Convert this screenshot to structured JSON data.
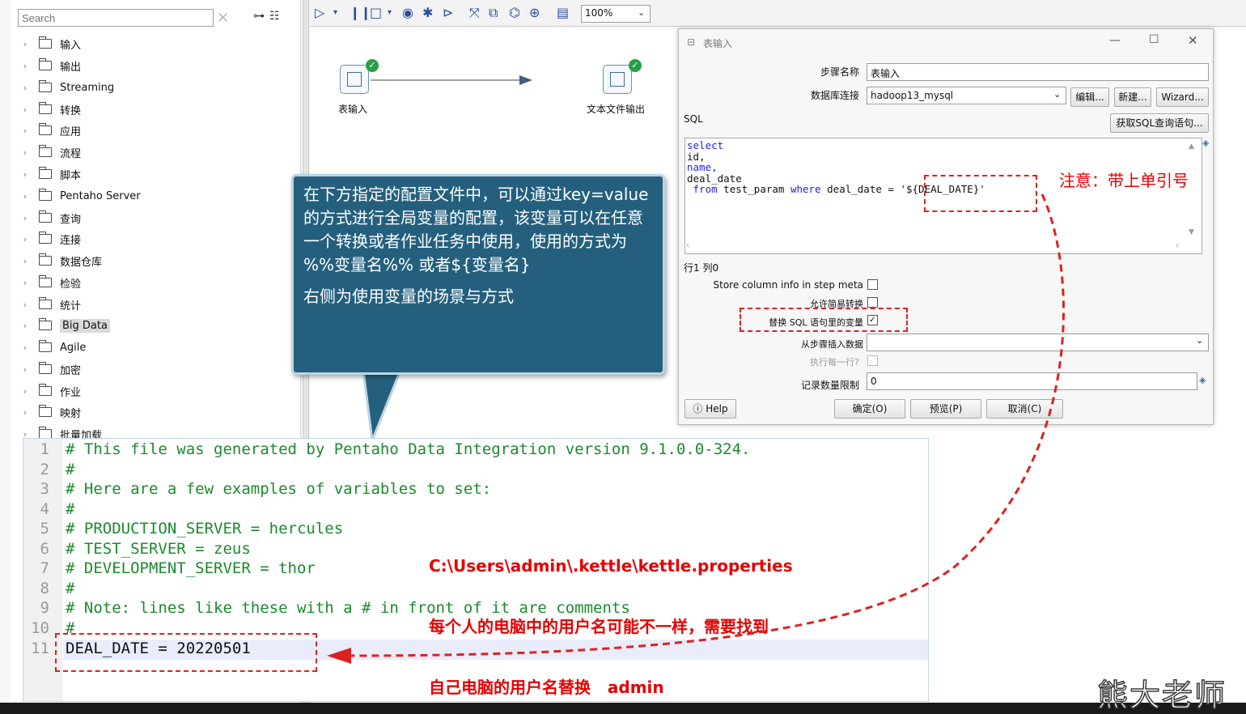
{
  "search": {
    "placeholder": "Search"
  },
  "tree": [
    {
      "label": "输入"
    },
    {
      "label": "输出"
    },
    {
      "label": "Streaming"
    },
    {
      "label": "转换"
    },
    {
      "label": "应用"
    },
    {
      "label": "流程"
    },
    {
      "label": "脚本"
    },
    {
      "label": "Pentaho Server"
    },
    {
      "label": "查询"
    },
    {
      "label": "连接"
    },
    {
      "label": "数据仓库"
    },
    {
      "label": "检验"
    },
    {
      "label": "统计"
    },
    {
      "label": "Big Data"
    },
    {
      "label": "Agile"
    },
    {
      "label": "加密"
    },
    {
      "label": "作业"
    },
    {
      "label": "映射"
    },
    {
      "label": "批量加载"
    }
  ],
  "toolbar": {
    "zoom": "100%"
  },
  "canvas": {
    "step1": "表输入",
    "step2": "文本文件输出"
  },
  "dialog": {
    "title": "表输入",
    "step_name_label": "步骤名称",
    "step_name_value": "表输入",
    "db_conn_label": "数据库连接",
    "db_conn_value": "hadoop13_mysql",
    "edit_btn": "编辑...",
    "new_btn": "新建...",
    "wizard_btn": "Wizard...",
    "sql_label": "SQL",
    "get_sql_btn": "获取SQL查询语句...",
    "sql": {
      "l1": "select",
      "l2": "id,",
      "l3": "name,",
      "l4": "deal_date",
      "l5_from": "from",
      "l5_mid": "test_param",
      "l5_where": "where",
      "l5_rest": "deal_date =",
      "l5_var": "'${DEAL_DATE}'"
    },
    "position": "行1 列0",
    "store_col_label": "Store column info in step meta",
    "lazy_label": "允许简易转换",
    "replace_var_label": "替换 SQL 语句里的变量",
    "insert_from_label": "从步骤插入数据",
    "exec_each_label": "执行每一行?",
    "limit_label": "记录数量限制",
    "limit_value": "0",
    "help_btn": "Help",
    "ok_btn": "确定(O)",
    "preview_btn": "预览(P)",
    "cancel_btn": "取消(C)"
  },
  "callout": {
    "p1": "在下方指定的配置文件中，可以通过key=value的方式进行全局变量的配置，该变量可以在任意一个转换或者作业任务中使用，使用的方式为 %%变量名%% 或者${变量名}",
    "p2": "右侧为使用变量的场景与方式"
  },
  "note_quote": "注意：带上单引号",
  "path_note": {
    "l1": "C:\\Users\\admin\\.kettle\\kettle.properties",
    "l2": "每个人的电脑中的用户名可能不一样，需要找到",
    "l3": "自己电脑的用户名替换   admin"
  },
  "editor": {
    "lines": [
      "# This file was generated by Pentaho Data Integration version 9.1.0.0-324.",
      "#",
      "# Here are a few examples of variables to set:",
      "#",
      "# PRODUCTION_SERVER = hercules",
      "# TEST_SERVER = zeus",
      "# DEVELOPMENT_SERVER = thor",
      "#",
      "# Note: lines like these with a # in front of it are comments",
      "#",
      "DEAL_DATE = 20220501"
    ],
    "numbers": [
      "1",
      "2",
      "3",
      "4",
      "5",
      "6",
      "7",
      "8",
      "9",
      "10",
      "11"
    ]
  },
  "watermark": "熊大老师",
  "colors": {
    "accent": "#24607e",
    "annotation": "#e02020",
    "comment": "#1c8a2e",
    "keyword": "#1e1ee6"
  }
}
